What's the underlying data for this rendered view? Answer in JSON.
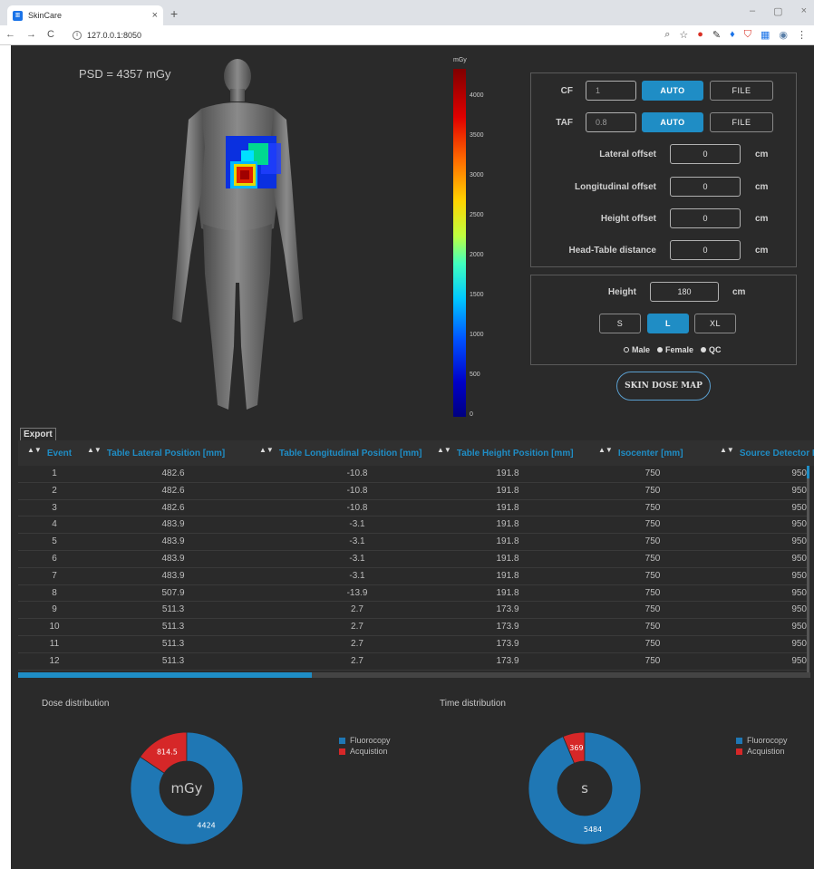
{
  "browser": {
    "tab_title": "SkinCare",
    "tab_close": "×",
    "new_tab": "+",
    "url": "127.0.0.1:8050",
    "nav": [
      "←",
      "→",
      "C"
    ],
    "window": [
      "–",
      "▢",
      "×"
    ]
  },
  "psd": "PSD = 4357 mGy",
  "colorbar": {
    "unit": "mGy",
    "ticks": [
      "4000",
      "3500",
      "3000",
      "2500",
      "2000",
      "1500",
      "1000",
      "500",
      "0"
    ]
  },
  "settings": {
    "cf": {
      "label": "CF",
      "value": "1",
      "auto": "AUTO",
      "file": "FILE"
    },
    "taf": {
      "label": "TAF",
      "value": "0.8",
      "auto": "AUTO",
      "file": "FILE"
    },
    "offsets": [
      {
        "label": "Lateral offset",
        "value": "0",
        "unit": "cm"
      },
      {
        "label": "Longitudinal offset",
        "value": "0",
        "unit": "cm"
      },
      {
        "label": "Height offset",
        "value": "0",
        "unit": "cm"
      },
      {
        "label": "Head-Table distance",
        "value": "0",
        "unit": "cm"
      }
    ]
  },
  "phantom": {
    "height_label": "Height",
    "height_value": "180",
    "height_unit": "cm",
    "sizes": [
      "S",
      "L",
      "XL"
    ],
    "selected_size": "L",
    "genders": [
      "Male",
      "Female",
      "QC"
    ],
    "selected_gender": "Male",
    "skin_dose_button": "SKIN DOSE MAP"
  },
  "table": {
    "export_label": "Export",
    "columns": [
      "Event",
      "Table Lateral Position [mm]",
      "Table Longitudinal Position [mm]",
      "Table Height Position [mm]",
      "Isocenter [mm]",
      "Source Detector D"
    ],
    "rows": [
      [
        "1",
        "482.6",
        "-10.8",
        "191.8",
        "750",
        "950"
      ],
      [
        "2",
        "482.6",
        "-10.8",
        "191.8",
        "750",
        "950"
      ],
      [
        "3",
        "482.6",
        "-10.8",
        "191.8",
        "750",
        "950"
      ],
      [
        "4",
        "483.9",
        "-3.1",
        "191.8",
        "750",
        "950"
      ],
      [
        "5",
        "483.9",
        "-3.1",
        "191.8",
        "750",
        "950"
      ],
      [
        "6",
        "483.9",
        "-3.1",
        "191.8",
        "750",
        "950"
      ],
      [
        "7",
        "483.9",
        "-3.1",
        "191.8",
        "750",
        "950"
      ],
      [
        "8",
        "507.9",
        "-13.9",
        "191.8",
        "750",
        "950"
      ],
      [
        "9",
        "511.3",
        "2.7",
        "173.9",
        "750",
        "950"
      ],
      [
        "10",
        "511.3",
        "2.7",
        "173.9",
        "750",
        "950"
      ],
      [
        "11",
        "511.3",
        "2.7",
        "173.9",
        "750",
        "950"
      ],
      [
        "12",
        "511.3",
        "2.7",
        "173.9",
        "750",
        "950"
      ]
    ]
  },
  "colors": {
    "fluoro": "#1f77b4",
    "acq": "#d62728",
    "accent": "#1f8dc5"
  },
  "chart_data": [
    {
      "type": "pie",
      "title": "Dose distribution",
      "center_label": "mGy",
      "categories": [
        "Fluorocopy",
        "Acquistion"
      ],
      "values": [
        4424,
        814.5
      ]
    },
    {
      "type": "pie",
      "title": "Time distribution",
      "center_label": "s",
      "categories": [
        "Fluorocopy",
        "Acquistion"
      ],
      "values": [
        5484,
        369
      ]
    }
  ]
}
